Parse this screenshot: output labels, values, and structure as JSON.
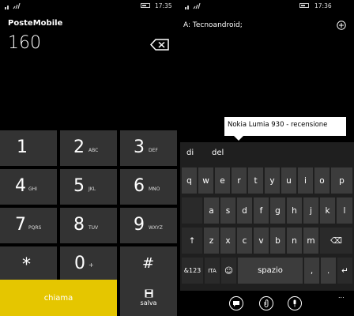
{
  "left": {
    "time": "17:35",
    "carrier": "PosteMobile",
    "dialed_number": "160",
    "keys": [
      {
        "digit": "1",
        "letters": ""
      },
      {
        "digit": "2",
        "letters": "ABC"
      },
      {
        "digit": "3",
        "letters": "DEF"
      },
      {
        "digit": "4",
        "letters": "GHI"
      },
      {
        "digit": "5",
        "letters": "JKL"
      },
      {
        "digit": "6",
        "letters": "MNO"
      },
      {
        "digit": "7",
        "letters": "PQRS"
      },
      {
        "digit": "8",
        "letters": "TUV"
      },
      {
        "digit": "9",
        "letters": "WXYZ"
      },
      {
        "digit": "*",
        "letters": ""
      },
      {
        "digit": "0",
        "letters": "+"
      },
      {
        "digit": "#",
        "letters": ""
      }
    ],
    "call_label": "chiama",
    "save_label": "salva",
    "call_color": "#e5c600"
  },
  "right": {
    "time": "17:36",
    "to_line": "A: Tecnoandroid;",
    "suggestion_popup": "Nokia Lumia 930 - recensione",
    "word_suggestions": [
      "di",
      "del"
    ],
    "row1": [
      "q",
      "w",
      "e",
      "r",
      "t",
      "y",
      "u",
      "i",
      "o",
      "p"
    ],
    "row2": [
      "a",
      "s",
      "d",
      "f",
      "g",
      "h",
      "j",
      "k",
      "l"
    ],
    "row3": [
      "↑",
      "z",
      "x",
      "c",
      "v",
      "b",
      "n",
      "m",
      "⌫"
    ],
    "row4": {
      "sym": "&123",
      "lang": "ITA",
      "emoji": "☺",
      "space": "spazio",
      "comma": ",",
      "dot": ".",
      "enter": "↵"
    },
    "more_label": "..."
  }
}
